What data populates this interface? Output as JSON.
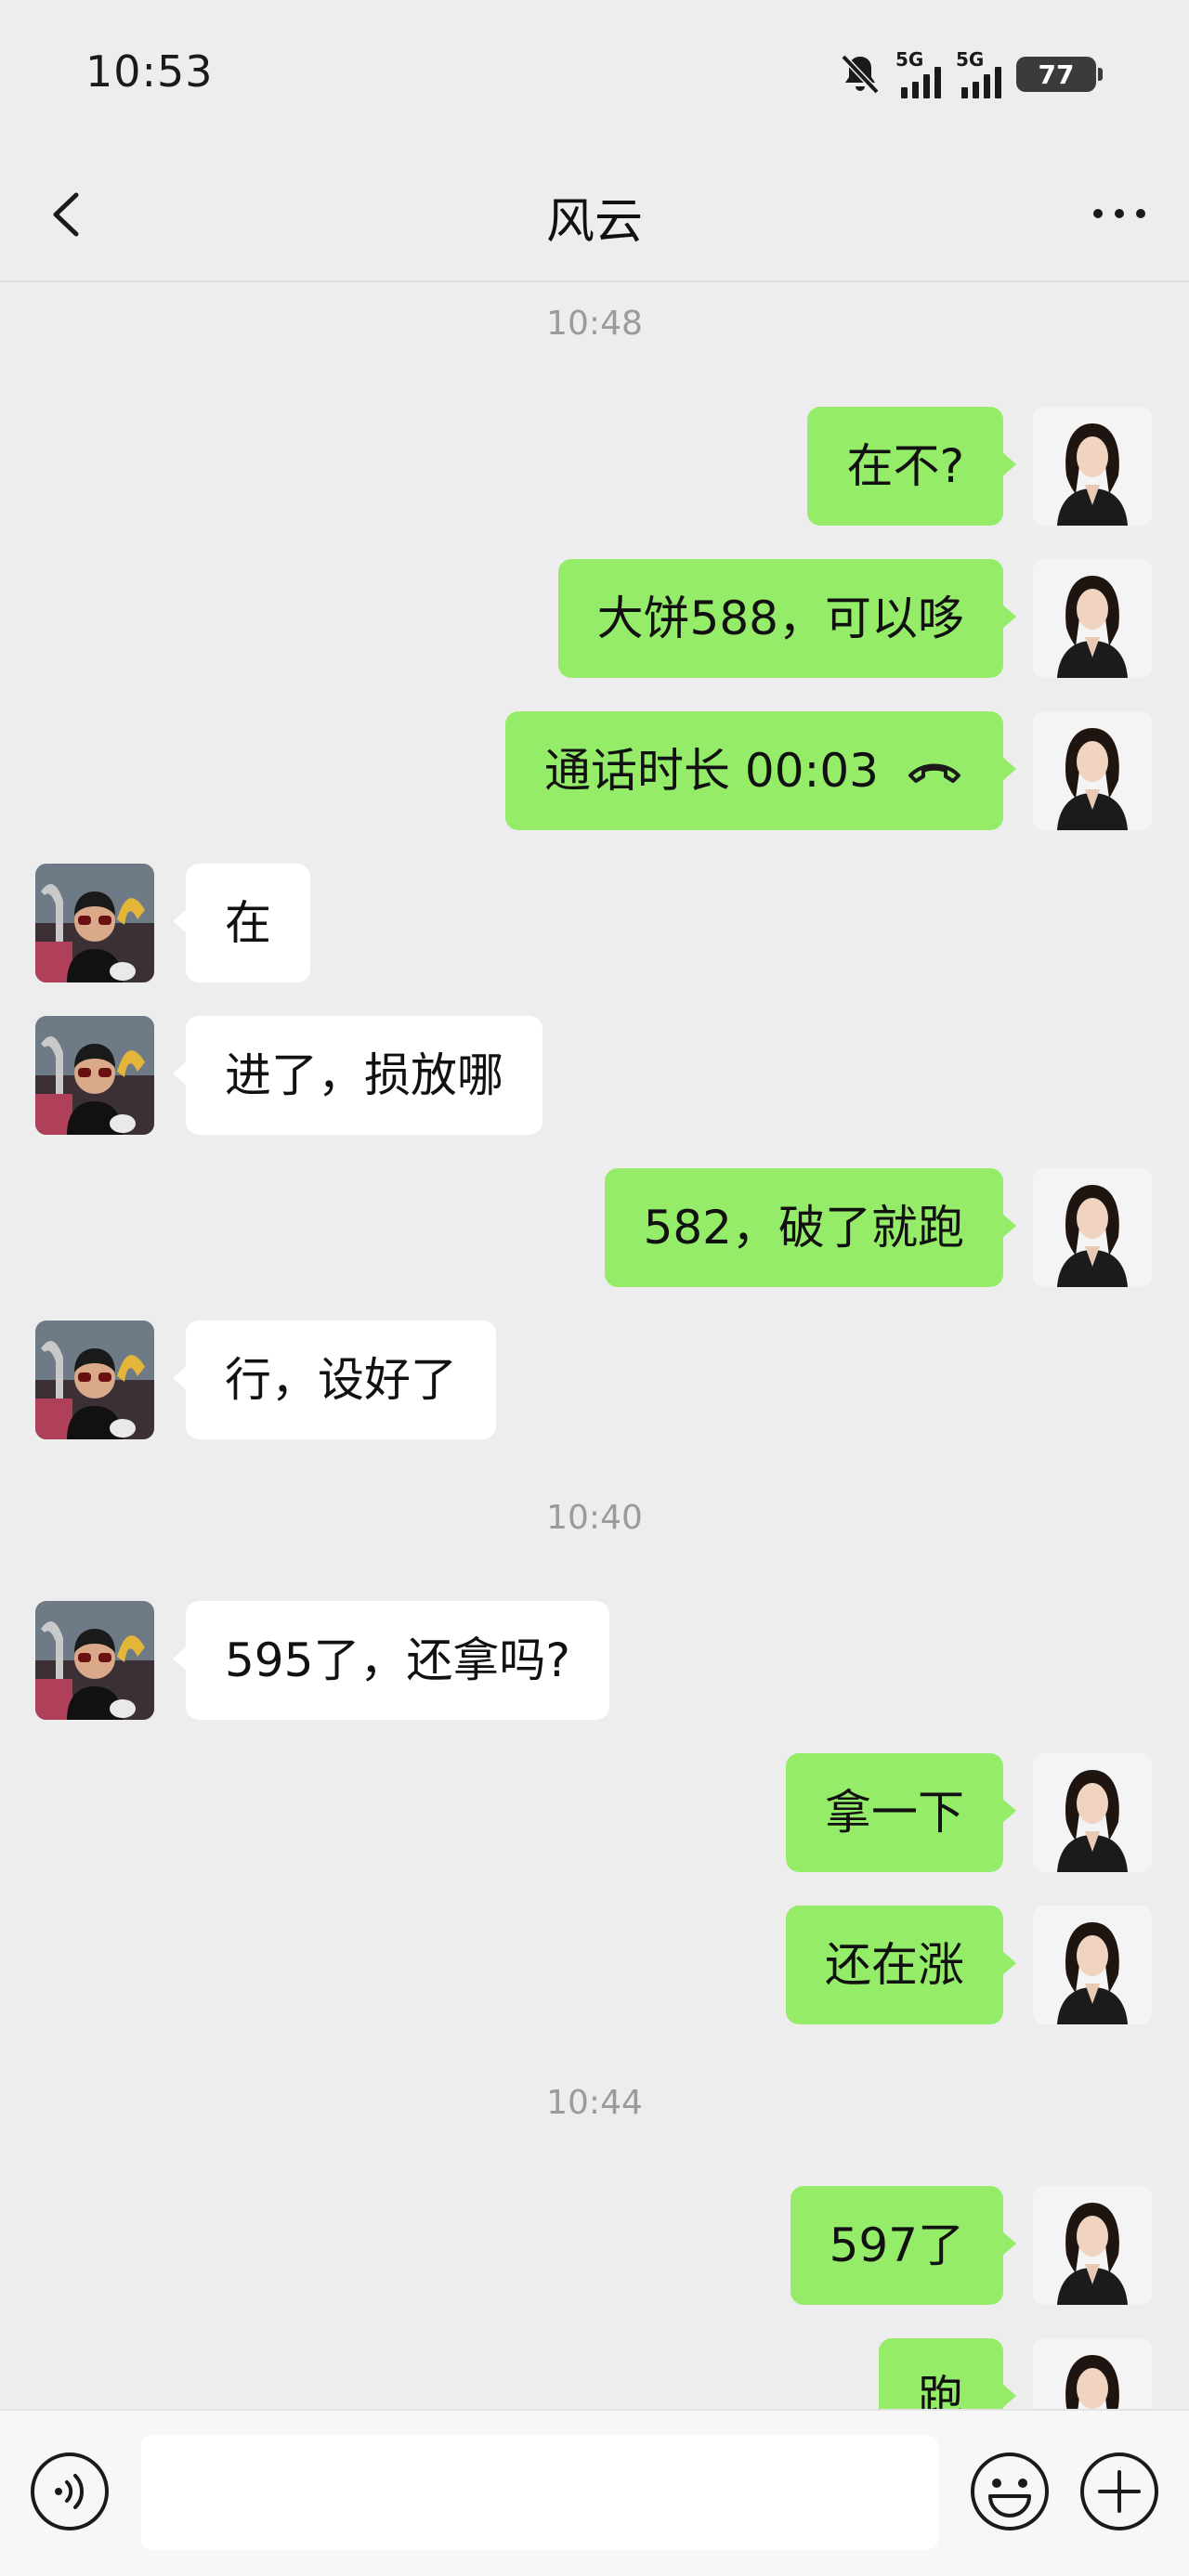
{
  "status_bar": {
    "time": "10:53",
    "network_1": "5G",
    "network_2": "5G",
    "battery": "77",
    "icons": [
      "mute-bell-icon",
      "signal-icon",
      "signal-icon",
      "battery-icon"
    ]
  },
  "header": {
    "title": "风云",
    "back_icon": "chevron-left-icon",
    "more_icon": "more-dots-icon"
  },
  "messages": [
    {
      "type": "timestamp",
      "text": "10:48"
    },
    {
      "type": "out",
      "text": "在不?"
    },
    {
      "type": "out",
      "text": "大饼588，可以哆"
    },
    {
      "type": "out",
      "text": "通话时长  00:03",
      "icon": "phone-hangup-icon"
    },
    {
      "type": "in",
      "text": "在"
    },
    {
      "type": "in",
      "text": "进了，损放哪"
    },
    {
      "type": "out",
      "text": "582，破了就跑"
    },
    {
      "type": "in",
      "text": "行，设好了"
    },
    {
      "type": "timestamp",
      "text": "10:40"
    },
    {
      "type": "in",
      "text": "595了，还拿吗?"
    },
    {
      "type": "out",
      "text": "拿一下"
    },
    {
      "type": "out",
      "text": "还在涨"
    },
    {
      "type": "timestamp",
      "text": "10:44"
    },
    {
      "type": "out",
      "text": "597了"
    },
    {
      "type": "out",
      "text": "跑"
    }
  ],
  "input_bar": {
    "placeholder": "",
    "voice_icon": "voice-icon",
    "emoji_icon": "emoji-icon",
    "plus_icon": "plus-icon"
  },
  "colors": {
    "background": "#ededed",
    "outgoing_bubble": "#95ec69",
    "incoming_bubble": "#ffffff",
    "timestamp": "#9b9b9b"
  }
}
